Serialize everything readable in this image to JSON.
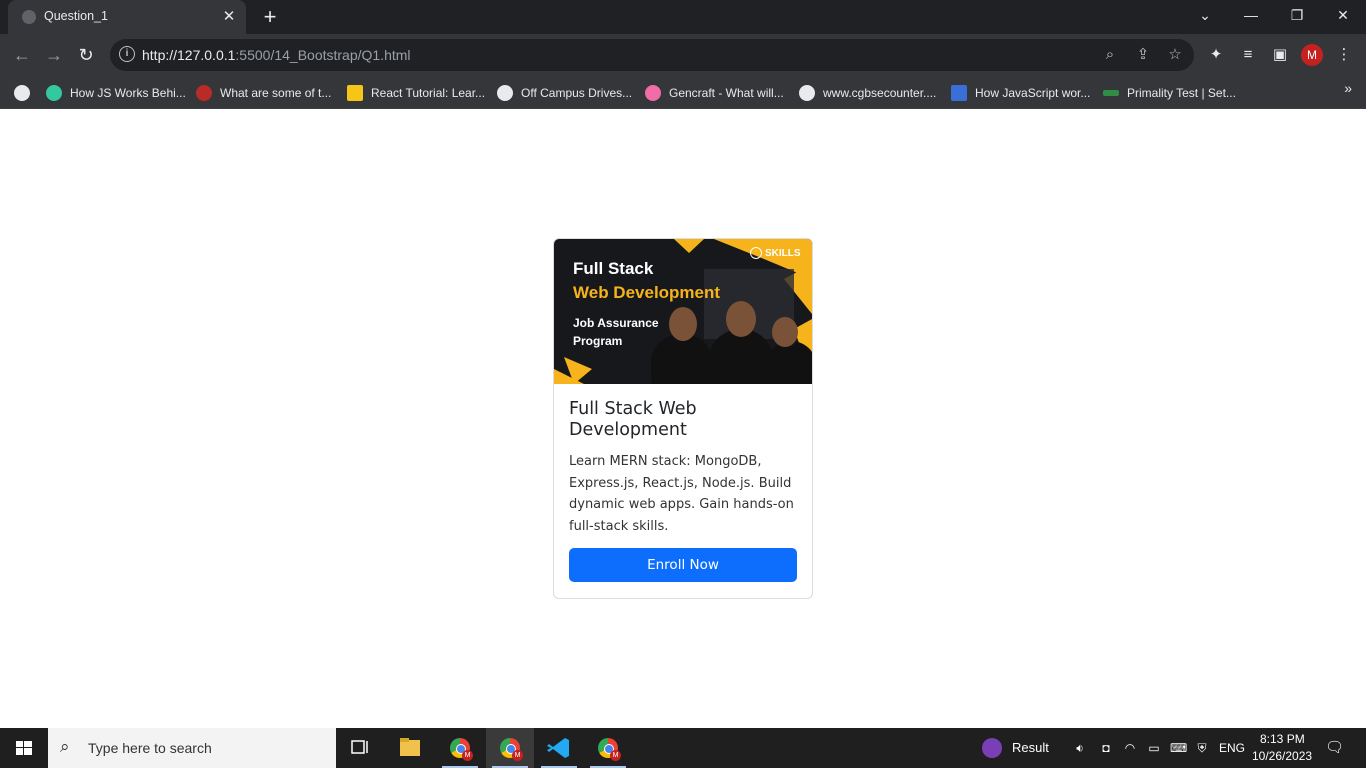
{
  "browser": {
    "tab_title": "Question_1",
    "url_host": "http://127.0.0.1",
    "url_rest": ":5500/14_Bootstrap/Q1.html",
    "avatar_letter": "M"
  },
  "bookmarks": [
    {
      "label": "How JS Works Behi...",
      "color": "#34c8a0"
    },
    {
      "label": "What are some of t...",
      "color": "#b92b27"
    },
    {
      "label": "React Tutorial: Lear...",
      "color": "#f5c518"
    },
    {
      "label": "Off Campus Drives...",
      "color": "#e8eaed"
    },
    {
      "label": "Gencraft - What will...",
      "color": "#f06da8"
    },
    {
      "label": "www.cgbsecounter....",
      "color": "#e8eaed"
    },
    {
      "label": "How JavaScript wor...",
      "color": "#3b6fd8"
    },
    {
      "label": "Primality Test | Set...",
      "color": "#2f8d46"
    }
  ],
  "card": {
    "banner": {
      "line1": "Full Stack",
      "line2": "Web Development",
      "line3": "Job Assurance Program",
      "brand": "SKILLS"
    },
    "title": "Full Stack Web Development",
    "text": "Learn MERN stack: MongoDB, Express.js, React.js, Node.js. Build dynamic web apps. Gain hands-on full-stack skills.",
    "button": "Enroll Now"
  },
  "taskbar": {
    "search_placeholder": "Type here to search",
    "result_label": "Result",
    "lang": "ENG",
    "time": "8:13 PM",
    "date": "10/26/2023"
  }
}
